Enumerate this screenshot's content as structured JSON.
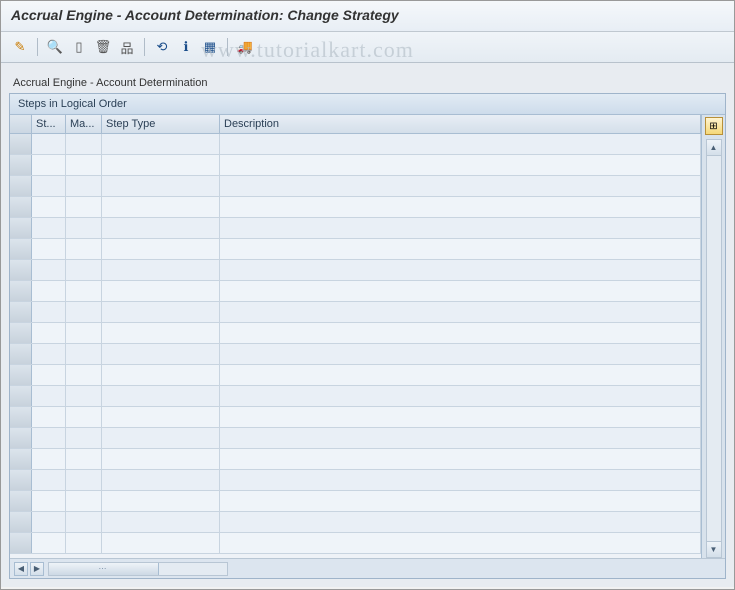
{
  "title": "Accrual Engine - Account Determination: Change Strategy",
  "toolbar": {
    "icons": [
      {
        "name": "pencil-icon",
        "glyph": "✎",
        "color": "#c97b00"
      },
      {
        "sep": true
      },
      {
        "name": "binoculars-icon",
        "glyph": "🔍",
        "color": "#1a4d8a"
      },
      {
        "name": "page-icon",
        "glyph": "▯",
        "color": "#555"
      },
      {
        "name": "trash-icon",
        "glyph": "🗑",
        "color": "#555"
      },
      {
        "name": "hierarchy-icon",
        "glyph": "品",
        "color": "#555"
      },
      {
        "sep": true
      },
      {
        "name": "undo-icon",
        "glyph": "⟲",
        "color": "#1a4d8a"
      },
      {
        "name": "info-icon",
        "glyph": "ℹ",
        "color": "#1a4d8a"
      },
      {
        "name": "table-icon",
        "glyph": "▦",
        "color": "#1a4d8a"
      },
      {
        "sep": true
      },
      {
        "name": "truck-icon",
        "glyph": "🚚",
        "color": "#c97b00"
      }
    ]
  },
  "section_label": "Accrual Engine - Account Determination",
  "panel": {
    "title": "Steps in Logical Order",
    "columns": [
      {
        "key": "st",
        "label": "St..."
      },
      {
        "key": "ma",
        "label": "Ma..."
      },
      {
        "key": "type",
        "label": "Step Type"
      },
      {
        "key": "desc",
        "label": "Description"
      }
    ],
    "rows": [
      {
        "st": "",
        "ma": "",
        "type": "",
        "desc": ""
      },
      {
        "st": "",
        "ma": "",
        "type": "",
        "desc": ""
      },
      {
        "st": "",
        "ma": "",
        "type": "",
        "desc": ""
      },
      {
        "st": "",
        "ma": "",
        "type": "",
        "desc": ""
      },
      {
        "st": "",
        "ma": "",
        "type": "",
        "desc": ""
      },
      {
        "st": "",
        "ma": "",
        "type": "",
        "desc": ""
      },
      {
        "st": "",
        "ma": "",
        "type": "",
        "desc": ""
      },
      {
        "st": "",
        "ma": "",
        "type": "",
        "desc": ""
      },
      {
        "st": "",
        "ma": "",
        "type": "",
        "desc": ""
      },
      {
        "st": "",
        "ma": "",
        "type": "",
        "desc": ""
      },
      {
        "st": "",
        "ma": "",
        "type": "",
        "desc": ""
      },
      {
        "st": "",
        "ma": "",
        "type": "",
        "desc": ""
      },
      {
        "st": "",
        "ma": "",
        "type": "",
        "desc": ""
      },
      {
        "st": "",
        "ma": "",
        "type": "",
        "desc": ""
      },
      {
        "st": "",
        "ma": "",
        "type": "",
        "desc": ""
      },
      {
        "st": "",
        "ma": "",
        "type": "",
        "desc": ""
      },
      {
        "st": "",
        "ma": "",
        "type": "",
        "desc": ""
      },
      {
        "st": "",
        "ma": "",
        "type": "",
        "desc": ""
      },
      {
        "st": "",
        "ma": "",
        "type": "",
        "desc": ""
      },
      {
        "st": "",
        "ma": "",
        "type": "",
        "desc": ""
      }
    ]
  },
  "watermark": "www.tutorialkart.com"
}
